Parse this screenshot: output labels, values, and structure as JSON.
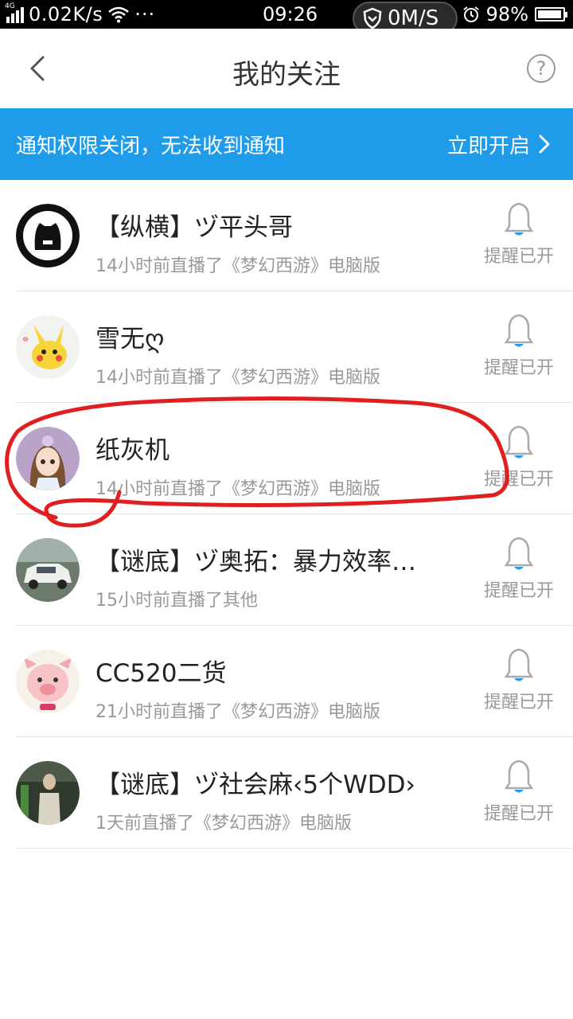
{
  "status_bar": {
    "network": "4G",
    "speed": "0.02K/s",
    "dots": "···",
    "time": "09:26",
    "pill_text": "0M/S",
    "battery": "98%",
    "battery_level": 0.98
  },
  "header": {
    "title": "我的关注",
    "help_symbol": "?"
  },
  "banner": {
    "message": "通知权限关闭，无法收到通知",
    "action": "立即开启"
  },
  "follows": [
    {
      "name": "【纵横】ヅ平头哥",
      "sub": "14小时前直播了《梦幻西游》电脑版",
      "remind": "提醒已开"
    },
    {
      "name": "雪无ღ",
      "sub": "14小时前直播了《梦幻西游》电脑版",
      "remind": "提醒已开"
    },
    {
      "name": "纸灰机",
      "sub": "14小时前直播了《梦幻西游》电脑版",
      "remind": "提醒已开"
    },
    {
      "name": "【谜底】ヅ奥拓：暴力效率…",
      "sub": "15小时前直播了其他",
      "remind": "提醒已开"
    },
    {
      "name": "CC520二货",
      "sub": "21小时前直播了《梦幻西游》电脑版",
      "remind": "提醒已开"
    },
    {
      "name": "【谜底】ヅ社会麻‹5个WDD›",
      "sub": "1天前直播了《梦幻西游》电脑版",
      "remind": "提醒已开"
    }
  ],
  "colors": {
    "accent": "#1e9be9",
    "annotation": "#e02020"
  }
}
